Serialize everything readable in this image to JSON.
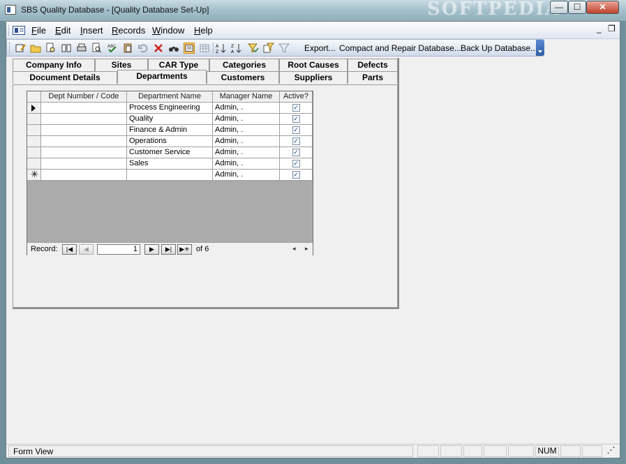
{
  "window": {
    "title": "SBS Quality Database - [Quality Database Set-Up]",
    "watermark": "SOFTPEDIA",
    "minimize_glyph": "—",
    "maximize_glyph": "☐",
    "close_glyph": "✕"
  },
  "menu": {
    "items": [
      "File",
      "Edit",
      "Insert",
      "Records",
      "Window",
      "Help"
    ],
    "mdi_minimize": "_",
    "mdi_restore": "❐"
  },
  "toolbar": {
    "export_label": "Export...",
    "compact_label": "Compact and Repair Database...",
    "backup_label": "Back Up Database..."
  },
  "tabs": {
    "row1": [
      "Company Info",
      "Sites",
      "CAR Type",
      "Categories",
      "Root Causes",
      "Defects"
    ],
    "row2": [
      "Document Details",
      "Departments",
      "Customers",
      "Suppliers",
      "Parts"
    ],
    "active": "Departments"
  },
  "datasheet": {
    "columns": [
      "Dept Number / Code",
      "Department Name",
      "Manager Name",
      "Active?"
    ],
    "rows": [
      {
        "code": "",
        "name": "Process Engineering",
        "manager": "Admin, .",
        "active": true
      },
      {
        "code": "",
        "name": "Quality",
        "manager": "Admin, .",
        "active": true
      },
      {
        "code": "",
        "name": "Finance & Admin",
        "manager": "Admin, .",
        "active": true
      },
      {
        "code": "",
        "name": "Operations",
        "manager": "Admin, .",
        "active": true
      },
      {
        "code": "",
        "name": "Customer Service",
        "manager": "Admin, .",
        "active": true
      },
      {
        "code": "",
        "name": "Sales",
        "manager": "Admin, .",
        "active": true
      }
    ],
    "new_row": {
      "code": "",
      "name": "",
      "manager": "Admin, .",
      "active": true
    },
    "checkmark": "✓",
    "new_record_glyph": "✳"
  },
  "navigation": {
    "label": "Record:",
    "current": "1",
    "of_text": "of  6"
  },
  "status": {
    "text": "Form View",
    "num": "NUM"
  },
  "colors": {
    "accent": "#2f5ea7",
    "grid_empty": "#ababab"
  }
}
